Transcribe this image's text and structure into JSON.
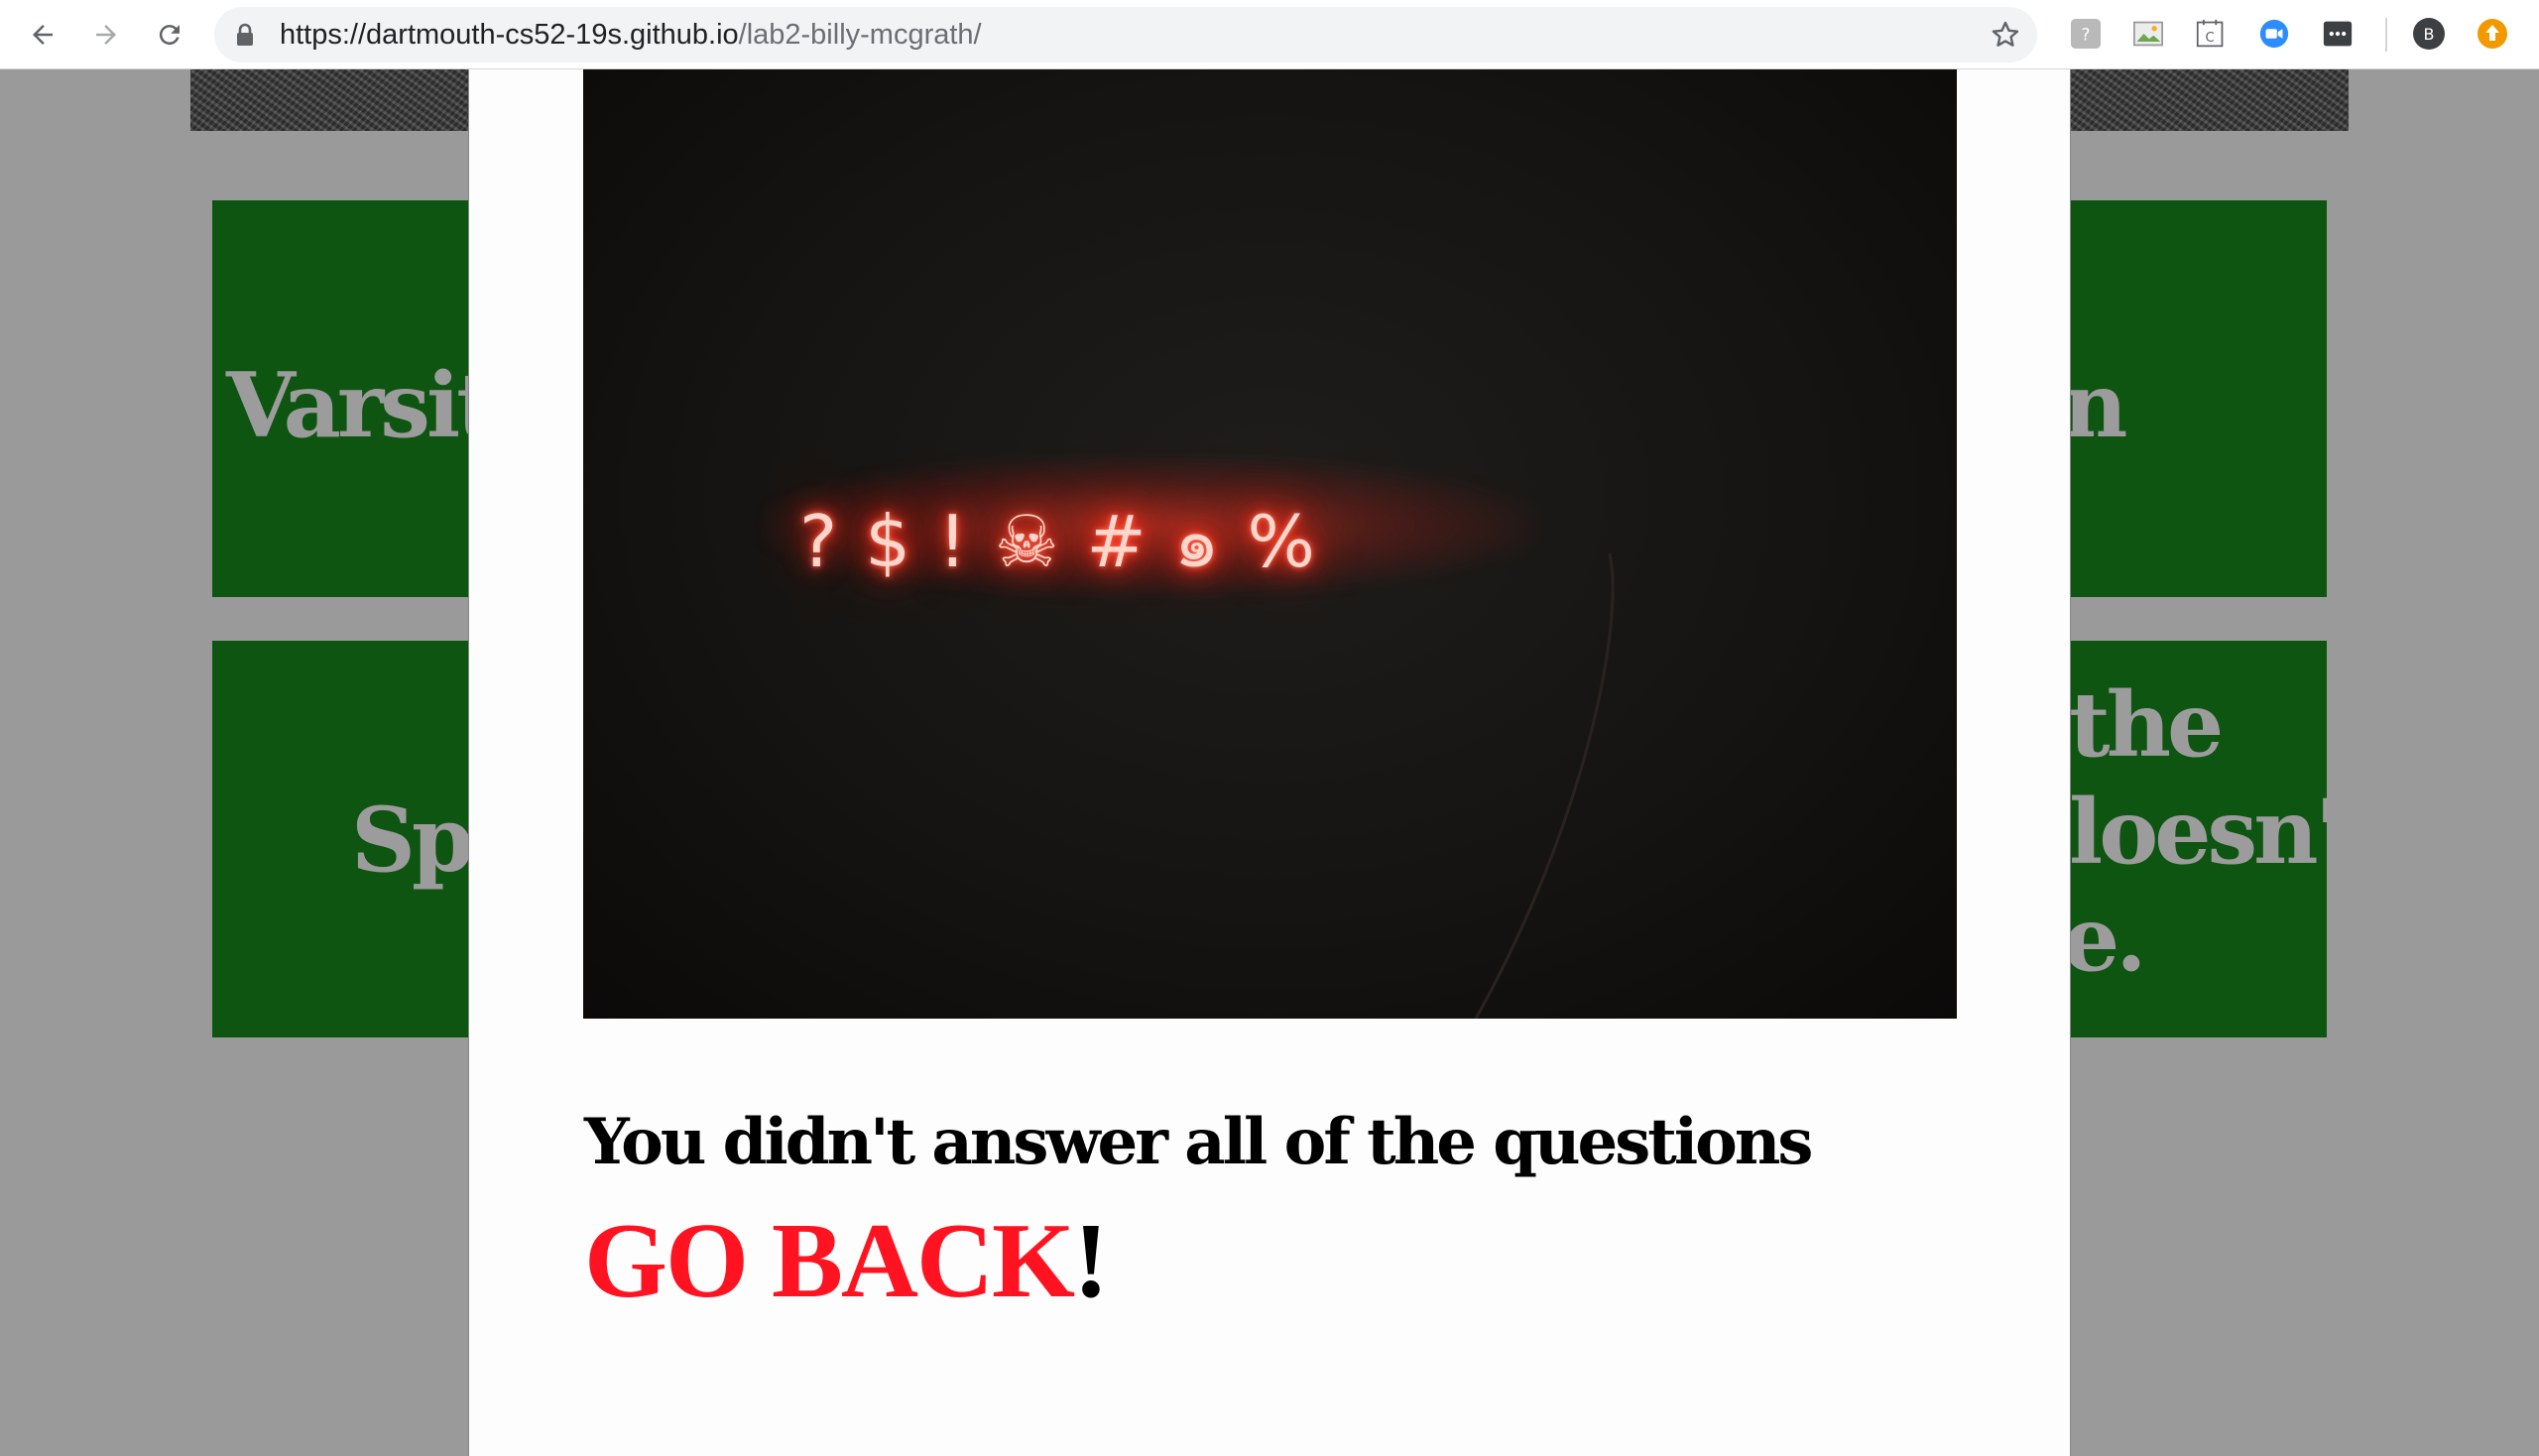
{
  "browser": {
    "url_host": "https://dartmouth-cs52-19s.github.io",
    "url_path": "/lab2-billy-mcgrath/",
    "profile_initial": "B",
    "extension_calendar_letter": "C"
  },
  "background_tiles": {
    "tile1_text": "Varsit",
    "tile2_text": "Sp",
    "tile3_text": "n",
    "tile4_line1": "the",
    "tile4_line2": "loesn't",
    "tile4_line3": "e."
  },
  "modal": {
    "photo_neon_symbols": "?$!☠#๑%",
    "message": "You didn't answer all of the questions",
    "go_back_label": "GO BACK",
    "go_back_suffix": "!"
  },
  "colors": {
    "tile_green": "#0e5511",
    "go_back_red": "#ff1321",
    "overlay_gray": "#9a9a9a"
  }
}
